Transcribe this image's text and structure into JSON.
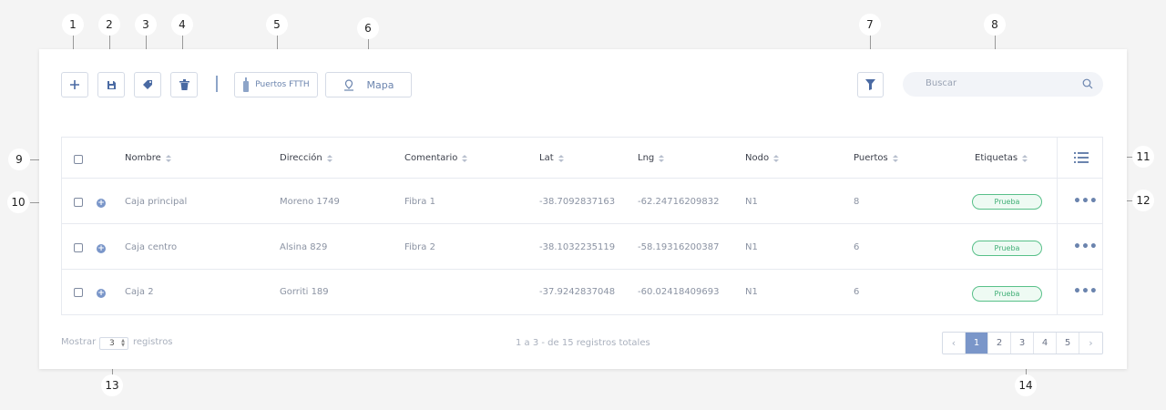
{
  "callouts": [
    "1",
    "2",
    "3",
    "4",
    "5",
    "6",
    "7",
    "8",
    "9",
    "10",
    "11",
    "12",
    "13",
    "14"
  ],
  "toolbar": {
    "ports_label": "Puertos FTTH",
    "map_label": "Mapa",
    "search_placeholder": "Buscar"
  },
  "table": {
    "columns": [
      "Nombre",
      "Dirección",
      "Comentario",
      "Lat",
      "Lng",
      "Nodo",
      "Puertos",
      "Etiquetas"
    ],
    "rows": [
      {
        "nombre": "Caja principal",
        "direccion": "Moreno 1749",
        "comentario": "Fibra 1",
        "lat": "-38.7092837163",
        "lng": "-62.24716209832",
        "nodo": "N1",
        "puertos": "8",
        "etiqueta": "Prueba"
      },
      {
        "nombre": "Caja centro",
        "direccion": "Alsina 829",
        "comentario": "Fibra 2",
        "lat": "-38.1032235119",
        "lng": "-58.19316200387",
        "nodo": "N1",
        "puertos": "6",
        "etiqueta": "Prueba"
      },
      {
        "nombre": "Caja 2",
        "direccion": "Gorriti 189",
        "comentario": "",
        "lat": "-37.9242837048",
        "lng": "-60.02418409693",
        "nodo": "N1",
        "puertos": "6",
        "etiqueta": "Prueba"
      }
    ]
  },
  "footer": {
    "show_label": "Mostrar",
    "page_size": "3",
    "records_label": "registros",
    "summary": "1 a 3 - de 15 registros totales"
  },
  "pagination": {
    "pages": [
      "1",
      "2",
      "3",
      "4",
      "5"
    ],
    "current": "1",
    "prev": "‹",
    "next": "›"
  },
  "colors": {
    "accent": "#7a96c9",
    "tag_green": "#58c089"
  }
}
